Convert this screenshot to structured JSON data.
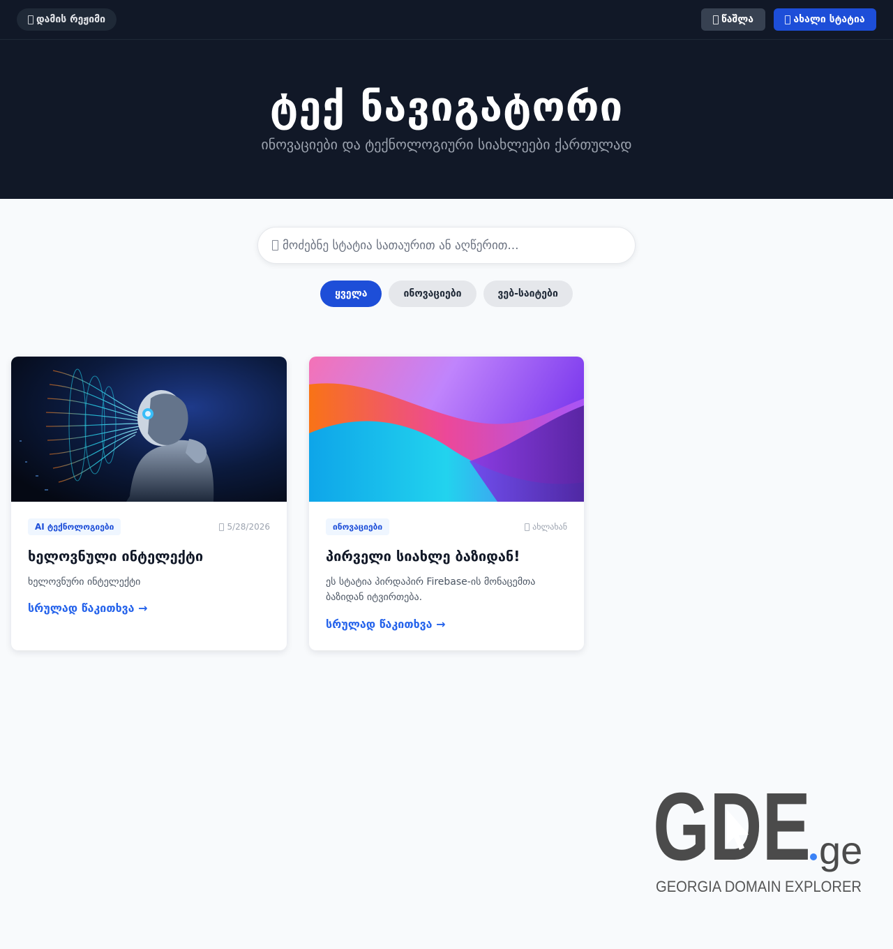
{
  "header": {
    "night_mode": "დამის რეჟიმი",
    "delete": "წაშლა",
    "new_article": "ახალი სტატია"
  },
  "hero": {
    "title": "ტექ ნავიგატორი",
    "subtitle": "ინოვაციები და ტექნოლოგიური სიახლეები ქართულად"
  },
  "search": {
    "placeholder": "მოძებნე სტატია სათაურით ან აღწერით..."
  },
  "filters": [
    "ყველა",
    "ინოვაციები",
    "ვებ-საიტები"
  ],
  "articles": [
    {
      "category": "AI ტექნოლოგიები",
      "date": "5/28/2026",
      "title": "ხელოვნული ინტელექტი",
      "description": "ხელოვნური ინტელექტი",
      "read_more": "სრულად წაკითხვა →"
    },
    {
      "category": "ინოვაციები",
      "date": "ახლახან",
      "title": "პირველი სიახლე ბაზიდან!",
      "description": "ეს სტატია პირდაპირ Firebase-ის მონაცემთა ბაზიდან იტვირთება.",
      "read_more": "სრულად წაკითხვა →"
    }
  ],
  "logo": {
    "name": "GDE",
    "tld": ".ge",
    "tagline": "GEORGIA DOMAIN EXPLORER"
  },
  "colors": {
    "accent": "#1d4ed8",
    "dark": "#111827",
    "link": "#2563eb"
  }
}
